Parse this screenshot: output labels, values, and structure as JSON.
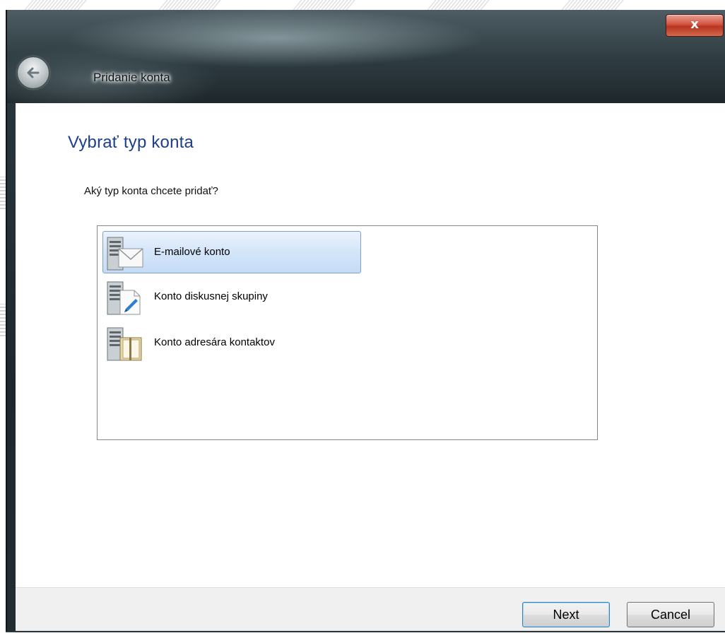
{
  "window": {
    "title": "Pridanie konta",
    "close_glyph": "x"
  },
  "page": {
    "heading": "Vybrať typ konta",
    "question": "Aký typ konta chcete pridať?"
  },
  "account_types": [
    {
      "label": "E-mailové konto",
      "icon": "email-account-icon",
      "selected": true
    },
    {
      "label": "Konto diskusnej skupiny",
      "icon": "newsgroup-account-icon",
      "selected": false
    },
    {
      "label": "Konto adresára kontaktov",
      "icon": "directory-account-icon",
      "selected": false
    }
  ],
  "footer": {
    "next_label": "Next",
    "cancel_label": "Cancel"
  },
  "colors": {
    "heading": "#1e3f8a",
    "selection": "#d4e5f9",
    "close_button": "#c8412b"
  }
}
